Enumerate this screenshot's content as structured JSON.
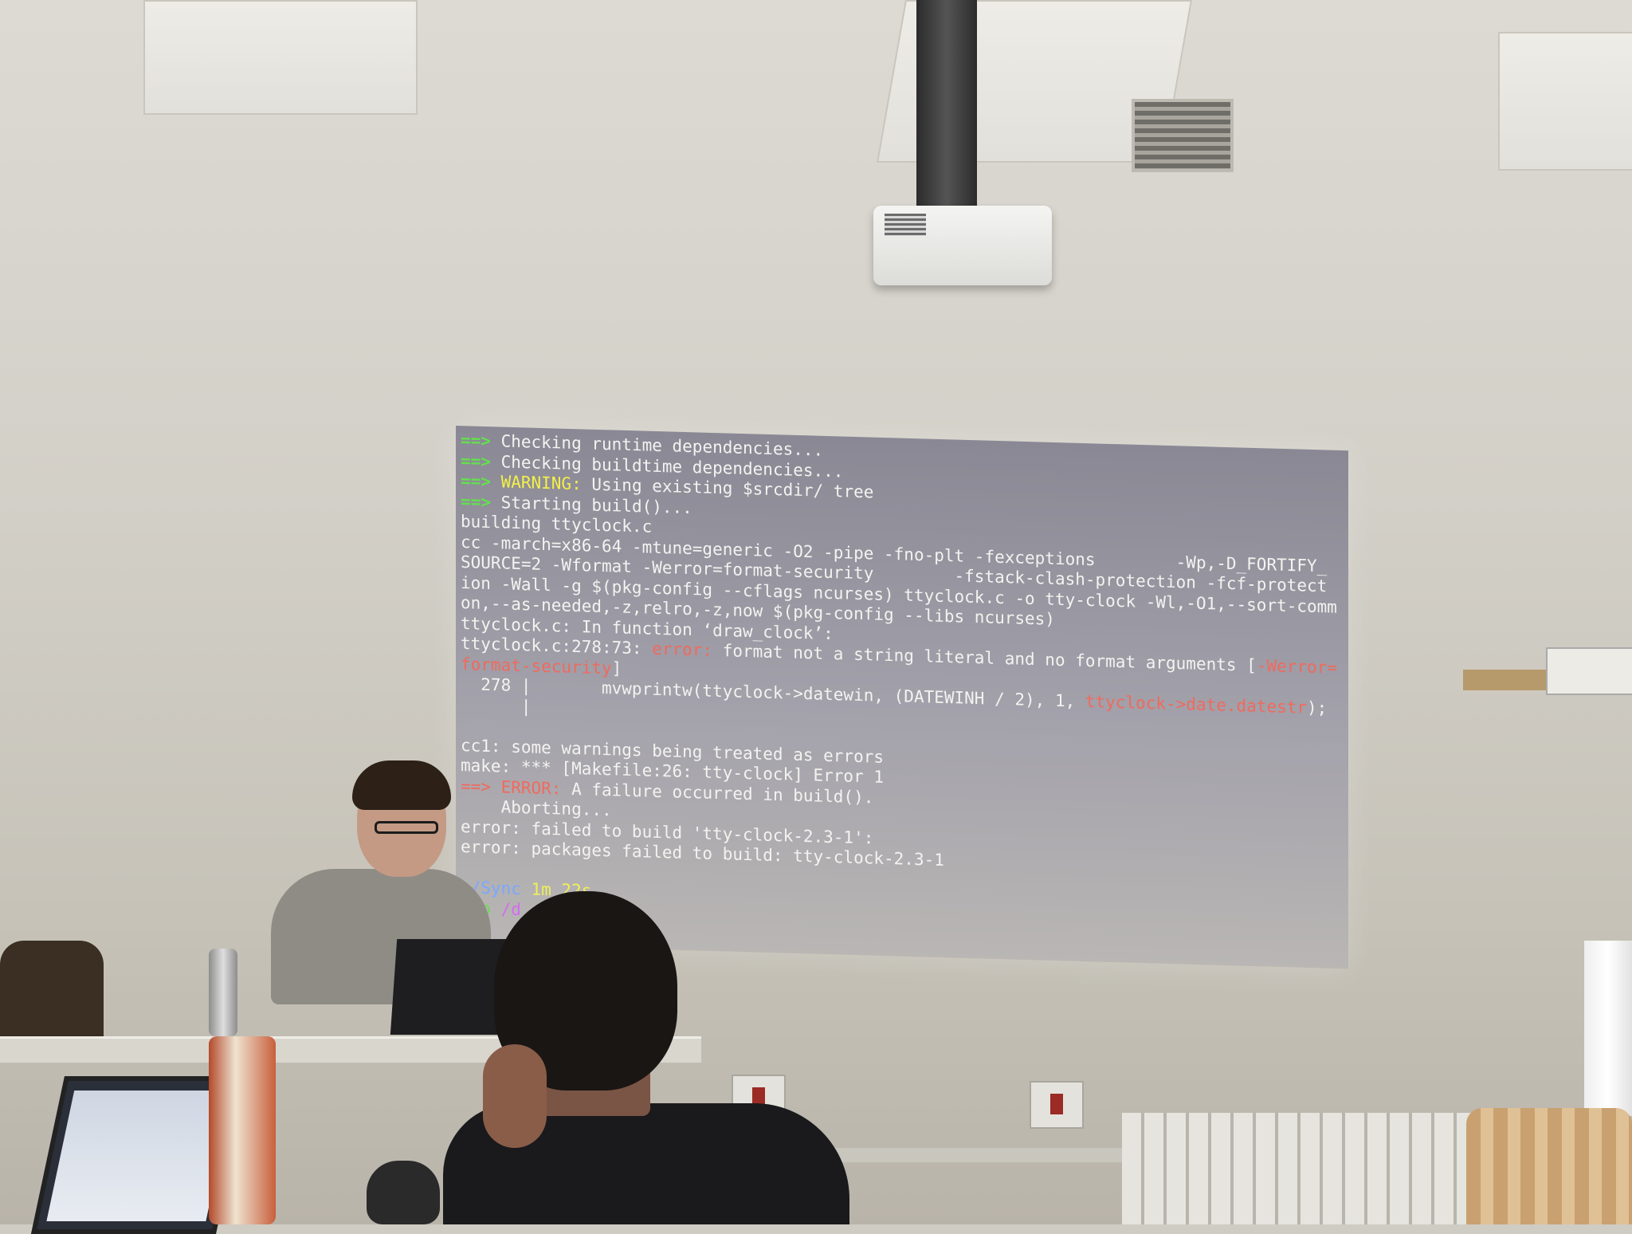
{
  "scene": {
    "description_free": true
  },
  "terminal": {
    "lines": [
      [
        {
          "t": "==> ",
          "c": "arrow"
        },
        {
          "t": "Checking runtime dependencies...",
          "c": ""
        }
      ],
      [
        {
          "t": "==> ",
          "c": "arrow"
        },
        {
          "t": "Checking buildtime dependencies...",
          "c": ""
        }
      ],
      [
        {
          "t": "==> ",
          "c": "arrow"
        },
        {
          "t": "WARNING:",
          "c": "warn"
        },
        {
          "t": " Using existing $srcdir/ tree",
          "c": ""
        }
      ],
      [
        {
          "t": "==> ",
          "c": "arrow"
        },
        {
          "t": "Starting build()...",
          "c": ""
        }
      ],
      [
        {
          "t": "building ttyclock.c",
          "c": ""
        }
      ],
      [
        {
          "t": "cc -march=x86-64 -mtune=generic -O2 -pipe -fno-plt -fexceptions        -Wp,-D_FORTIFY_",
          "c": ""
        }
      ],
      [
        {
          "t": "SOURCE=2 -Wformat -Werror=format-security        -fstack-clash-protection -fcf-protect",
          "c": ""
        }
      ],
      [
        {
          "t": "ion -Wall -g $(pkg-config --cflags ncurses) ttyclock.c -o tty-clock -Wl,-O1,--sort-comm",
          "c": ""
        }
      ],
      [
        {
          "t": "on,--as-needed,-z,relro,-z,now $(pkg-config --libs ncurses)",
          "c": ""
        }
      ],
      [
        {
          "t": "ttyclock.c: In function ‘draw_clock’:",
          "c": ""
        }
      ],
      [
        {
          "t": "ttyclock.c:278:73: ",
          "c": ""
        },
        {
          "t": "error:",
          "c": "err"
        },
        {
          "t": " format not a string literal and no format arguments [",
          "c": ""
        },
        {
          "t": "-Werror=",
          "c": "err"
        }
      ],
      [
        {
          "t": "format-security",
          "c": "err"
        },
        {
          "t": "]",
          "c": ""
        }
      ],
      [
        {
          "t": "  278 |       mvwprintw(ttyclock->datewin, (DATEWINH / 2), 1, ",
          "c": ""
        },
        {
          "t": "ttyclock->date.datestr",
          "c": "err"
        },
        {
          "t": ");",
          "c": ""
        }
      ],
      [
        {
          "t": "      |",
          "c": ""
        }
      ],
      [
        {
          "t": "",
          "c": ""
        }
      ],
      [
        {
          "t": "cc1: some warnings being treated as errors",
          "c": ""
        }
      ],
      [
        {
          "t": "make: *** [Makefile:26: tty-clock] Error 1",
          "c": ""
        }
      ],
      [
        {
          "t": "==> ",
          "c": "err"
        },
        {
          "t": "ERROR:",
          "c": "err"
        },
        {
          "t": " A failure occurred in build().",
          "c": ""
        }
      ],
      [
        {
          "t": "    Aborting...",
          "c": ""
        }
      ],
      [
        {
          "t": "error: failed to build 'tty-clock-2.3-1':",
          "c": ""
        }
      ],
      [
        {
          "t": "error: packages failed to build: tty-clock-2.3-1",
          "c": ""
        }
      ],
      [
        {
          "t": "",
          "c": ""
        }
      ],
      [
        {
          "t": "~/Sync",
          "c": "prompt-dir"
        },
        {
          "t": " 1m 22s",
          "c": "prompt-time"
        }
      ],
      [
        {
          "t": "tio",
          "c": "prompt-2"
        },
        {
          "t": " /d",
          "c": "prompt-3"
        }
      ]
    ]
  },
  "colors": {
    "arrow": "#62e04e",
    "warning": "#f2f04a",
    "error": "#f06a5e",
    "prompt_dir": "#7aa8ff",
    "prompt_time": "#f0ee5a"
  }
}
